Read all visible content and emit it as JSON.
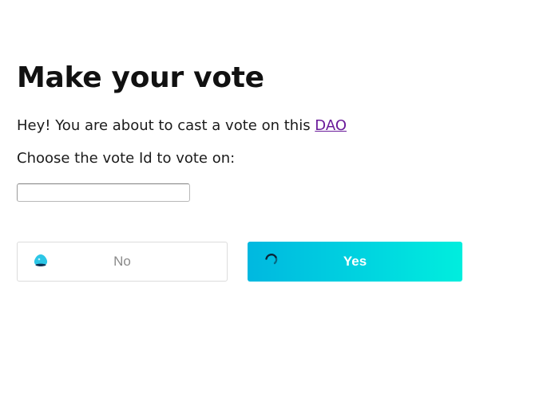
{
  "page": {
    "title": "Make your vote",
    "intro_text": "Hey! You are about to cast a vote on this ",
    "dao_link": "DAO",
    "prompt": "Choose the vote Id to vote on:"
  },
  "vote_input": {
    "value": "",
    "placeholder": ""
  },
  "buttons": {
    "no_label": "No",
    "yes_label": "Yes",
    "no_icon": "aragon-logo-icon",
    "yes_icon": "loading-spinner-icon"
  },
  "colors": {
    "link": "#6a1b9a",
    "yes_gradient_start": "#00b8e0",
    "yes_gradient_end": "#00eede"
  }
}
